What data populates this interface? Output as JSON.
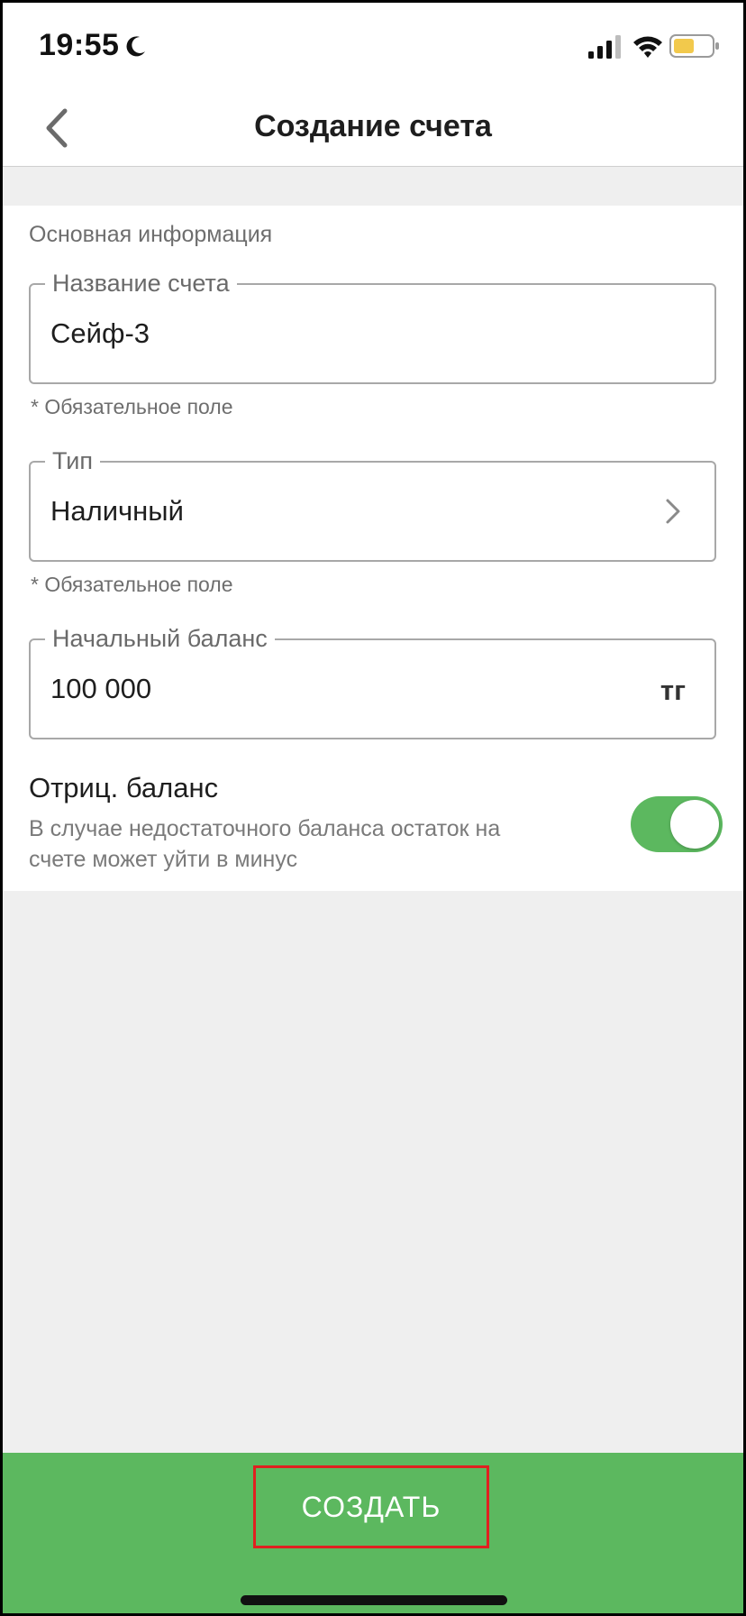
{
  "status_bar": {
    "time": "19:55",
    "icons": [
      "moon-icon",
      "signal-icon",
      "wifi-icon",
      "battery-icon"
    ],
    "battery_color": "#f2c94c"
  },
  "header": {
    "title": "Создание счета",
    "back_icon": "chevron-left-icon"
  },
  "form": {
    "section_title": "Основная информация",
    "account_name": {
      "label": "Название счета",
      "value": "Сейф-3",
      "helper": "* Обязательное поле"
    },
    "type": {
      "label": "Тип",
      "value": "Наличный",
      "helper": "* Обязательное поле",
      "icon": "chevron-right-icon"
    },
    "initial_balance": {
      "label": "Начальный баланс",
      "value": "100 000",
      "currency": "тг"
    },
    "negative_balance": {
      "title": "Отриц. баланс",
      "description": "В случае недостаточного баланса остаток на счете может уйти в минус",
      "enabled": true
    }
  },
  "footer": {
    "create_label": "СОЗДАТЬ"
  },
  "colors": {
    "accent": "#5cb85f",
    "highlight_border": "#e02020",
    "background": "#efefef"
  }
}
